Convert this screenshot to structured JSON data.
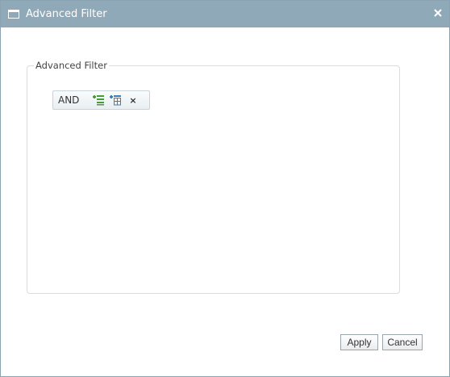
{
  "dialog": {
    "title": "Advanced Filter",
    "close_symbol": "×"
  },
  "filter_group": {
    "legend": "Advanced Filter",
    "node": {
      "operator": "AND",
      "add_condition_icon": "add-condition-icon",
      "add_group_icon": "add-group-icon",
      "remove_symbol": "×"
    }
  },
  "footer": {
    "apply_label": "Apply",
    "cancel_label": "Cancel"
  },
  "colors": {
    "titlebar": "#8fa9b8",
    "icon_green": "#4a9a3a",
    "icon_blue": "#3f7fb8"
  }
}
